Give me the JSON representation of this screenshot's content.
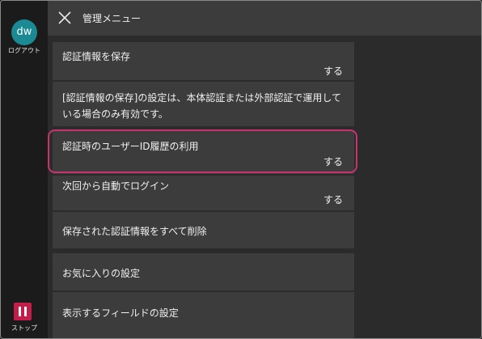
{
  "sidebar": {
    "avatar_text": "dw",
    "logout_label": "ログアウト",
    "stop_label": "ストップ"
  },
  "header": {
    "title": "管理メニュー"
  },
  "menu": {
    "save_auth_info": {
      "label": "認証情報を保存",
      "value": "する"
    },
    "note": "[認証情報の保存]の設定は、本体認証または外部認証で運用している場合のみ有効です。",
    "user_id_history": {
      "label": "認証時のユーザーID履歴の利用",
      "value": "する"
    },
    "auto_login": {
      "label": "次回から自動でログイン",
      "value": "する"
    },
    "delete_all": {
      "label": "保存された認証情報をすべて削除"
    },
    "favorites": {
      "label": "お気に入りの設定"
    },
    "display_fields": {
      "label": "表示するフィールドの設定"
    }
  },
  "colors": {
    "avatar": "#1c8a93",
    "stop": "#c41d4a",
    "highlight": "#c9326c"
  }
}
